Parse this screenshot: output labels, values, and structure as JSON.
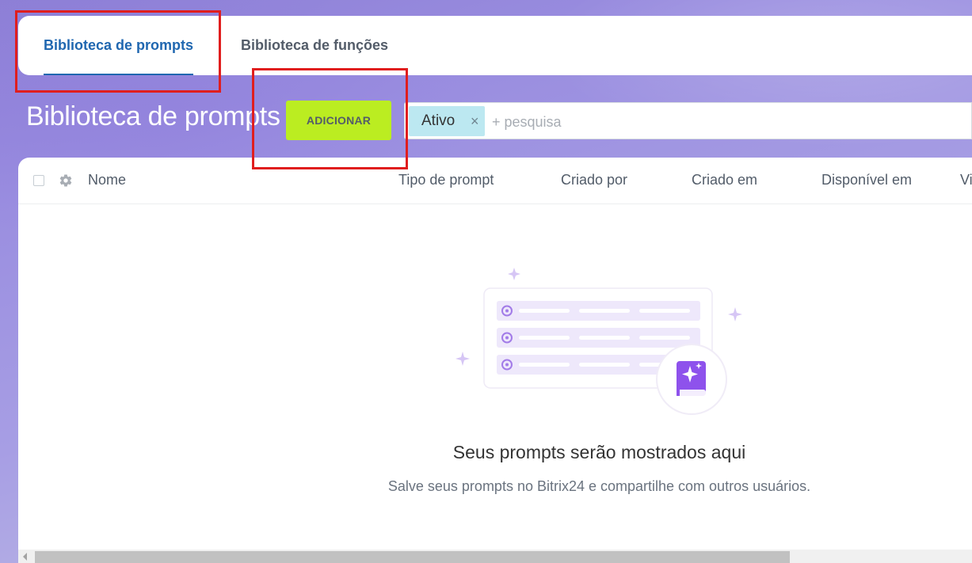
{
  "tabs": [
    {
      "label": "Biblioteca de prompts",
      "active": true
    },
    {
      "label": "Biblioteca de funções",
      "active": false
    }
  ],
  "toolbar": {
    "title": "Biblioteca de prompts",
    "add_label": "ADICIONAR"
  },
  "search": {
    "filter_chip": "Ativo",
    "chip_close": "×",
    "placeholder": "+ pesquisa"
  },
  "grid": {
    "columns": [
      "Nome",
      "Tipo de prompt",
      "Criado por",
      "Criado em",
      "Disponível em",
      "Vi"
    ]
  },
  "empty_state": {
    "title": "Seus prompts serão mostrados aqui",
    "subtitle": "Salve seus prompts no Bitrix24 e compartilhe com outros usuários."
  },
  "icons": {
    "settings": "gear-icon",
    "illustration": "prompt-library-illustration",
    "book": "sparkle-book-icon",
    "scroll_left": "chevron-left-icon"
  },
  "colors": {
    "accent_tab": "#2067b0",
    "add_button": "#bbed21",
    "filter_chip": "#bce8f1",
    "illustration_purple": "#8e52ec",
    "annotation_red": "#e01e1e"
  }
}
